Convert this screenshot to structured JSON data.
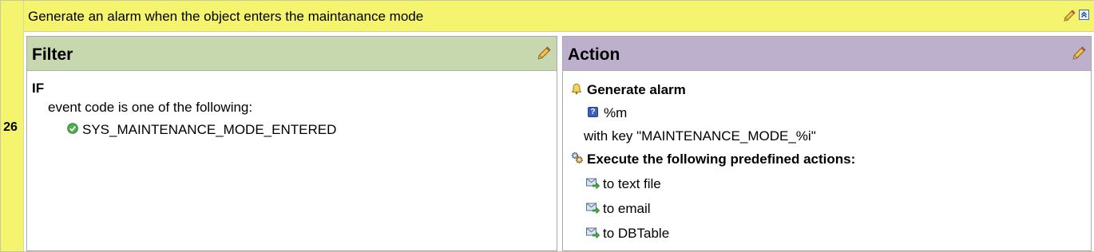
{
  "rule": {
    "number": "26",
    "title": "Generate an alarm when the object enters the maintanance mode"
  },
  "filter": {
    "title": "Filter",
    "if_label": "IF",
    "condition": "event code is one of the following:",
    "event_codes": [
      "SYS_MAINTENANCE_MODE_ENTERED"
    ]
  },
  "action": {
    "title": "Action",
    "generate_alarm_label": "Generate alarm",
    "alarm_message": "%m",
    "alarm_key": "with key \"MAINTENANCE_MODE_%i\"",
    "execute_label": "Execute the following predefined actions:",
    "predefined_actions": [
      "to text file",
      "to email",
      "to DBTable"
    ]
  },
  "colors": {
    "rule_background": "#f4f46e",
    "filter_header": "#c8d8ae",
    "action_header": "#bdb0cd"
  }
}
